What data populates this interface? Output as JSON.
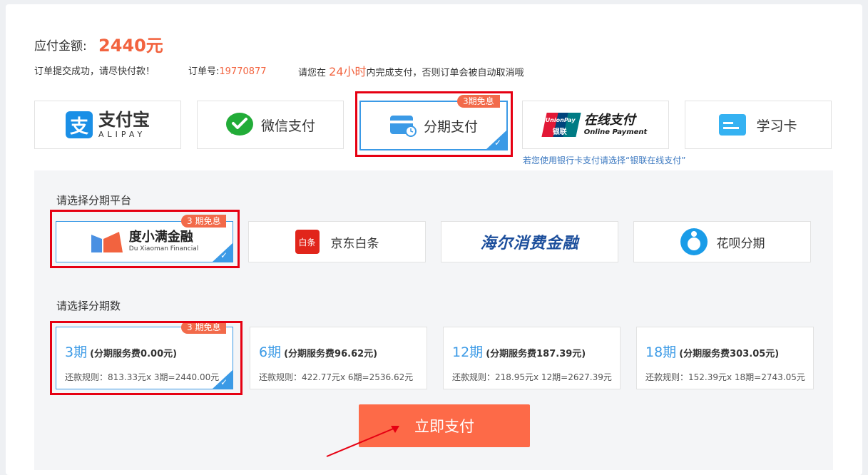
{
  "order": {
    "amount_label": "应付金额:",
    "amount_value": "2440元",
    "success_text": "订单提交成功，请尽快付款！",
    "order_no_label": "订单号:",
    "order_no_value": "19770877",
    "deadline_prefix": "请您在",
    "deadline_hours": "24小时",
    "deadline_suffix": "内完成支付，否则订单会被自动取消哦"
  },
  "payment_methods": {
    "alipay_name": "支付宝",
    "alipay_sub": "ALIPAY",
    "wechat_label": "微信支付",
    "installment_label": "分期支付",
    "installment_badge": "3期免息",
    "unionpay_logo_cn": "银联",
    "unionpay_logo_en": "UnionPay",
    "unionpay_label": "在线支付",
    "unionpay_sub": "Online Payment",
    "study_card_label": "学习卡",
    "bank_hint": "若您使用银行卡支付请选择“银联在线支付”"
  },
  "platforms": {
    "title": "请选择分期平台",
    "badge": "3 期免息",
    "duxiaoman_label": "度小满金融",
    "duxiaoman_sub": "Du Xiaoman Financial",
    "jd_icon_text": "白条",
    "jd_label": "京东白条",
    "haier_label": "海尔消费金融",
    "huabei_label": "花呗分期"
  },
  "installments": {
    "title": "请选择分期数",
    "badge": "3 期免息",
    "options": [
      {
        "period": "3期",
        "fee": "(分期服务费0.00元)",
        "rule": "还款规则：813.33元x 3期=2440.00元"
      },
      {
        "period": "6期",
        "fee": "(分期服务费96.62元)",
        "rule": "还款规则：422.77元x 6期=2536.62元"
      },
      {
        "period": "12期",
        "fee": "(分期服务费187.39元)",
        "rule": "还款规则：218.95元x 12期=2627.39元"
      },
      {
        "period": "18期",
        "fee": "(分期服务费303.05元)",
        "rule": "还款规则：152.39元x 18期=2743.05元"
      }
    ]
  },
  "pay_button_label": "立即支付",
  "colors": {
    "accent_blue": "#3b9ae6",
    "price_red": "#f2633f",
    "button_orange": "#fd6a48",
    "highlight_red": "#e60012"
  }
}
